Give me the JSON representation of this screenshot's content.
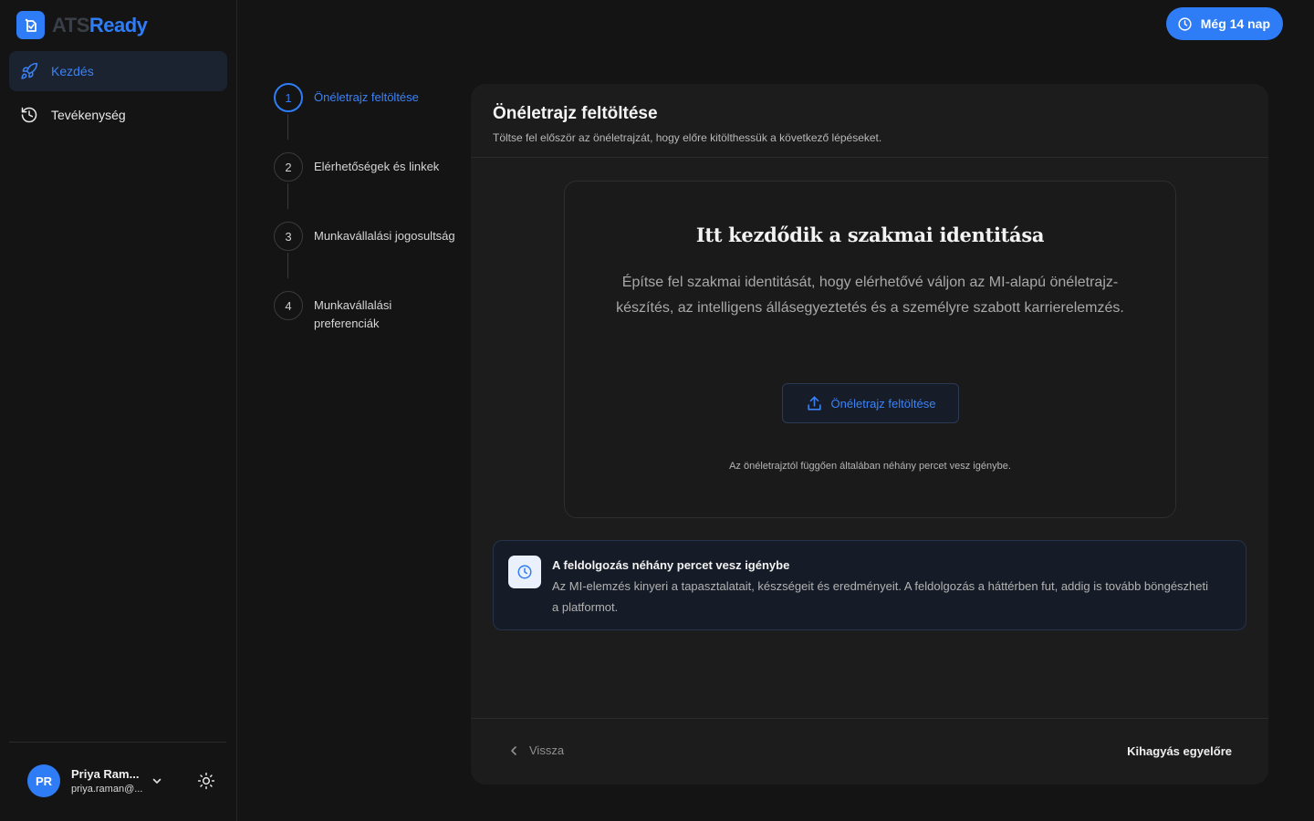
{
  "brand": {
    "name_part1": "ATS",
    "name_part2": "Ready",
    "accent": "#2f7df6"
  },
  "sidebar": {
    "items": [
      {
        "label": "Kezdés",
        "icon": "rocket-icon",
        "active": true
      },
      {
        "label": "Tevékenység",
        "icon": "history-icon",
        "active": false
      }
    ]
  },
  "user": {
    "initials": "PR",
    "name": "Priya Ram...",
    "email": "priya.raman@..."
  },
  "trial": {
    "label": "Még 14 nap",
    "icon": "clock-icon"
  },
  "stepper": {
    "steps": [
      {
        "number": "1",
        "label": "Önéletrajz feltöltése",
        "active": true
      },
      {
        "number": "2",
        "label": "Elérhetőségek és linkek",
        "active": false
      },
      {
        "number": "3",
        "label": "Munkavállalási jogosultság",
        "active": false
      },
      {
        "number": "4",
        "label": "Munkavállalási preferenciák",
        "active": false
      }
    ]
  },
  "card": {
    "title": "Önéletrajz feltöltése",
    "subtitle": "Töltse fel először az önéletrajzát, hogy előre kitölthessük a következő lépéseket."
  },
  "upload": {
    "title": "Itt kezdődik a szakmai identitása",
    "description": "Építse fel szakmai identitását, hogy elérhetővé váljon az MI-alapú önéletrajz-készítés, az intelligens állásegyeztetés és a személyre szabott karrierelemzés.",
    "button_label": "Önéletrajz feltöltése",
    "note": "Az önéletrajztól függően általában néhány percet vesz igénybe."
  },
  "info": {
    "title": "A feldolgozás néhány percet vesz igénybe",
    "text": "Az MI-elemzés kinyeri a tapasztalatait, készségeit és eredményeit. A feldolgozás a háttérben fut, addig is tovább böngészheti a platformot."
  },
  "footer": {
    "back_label": "Vissza",
    "skip_label": "Kihagyás egyelőre"
  }
}
